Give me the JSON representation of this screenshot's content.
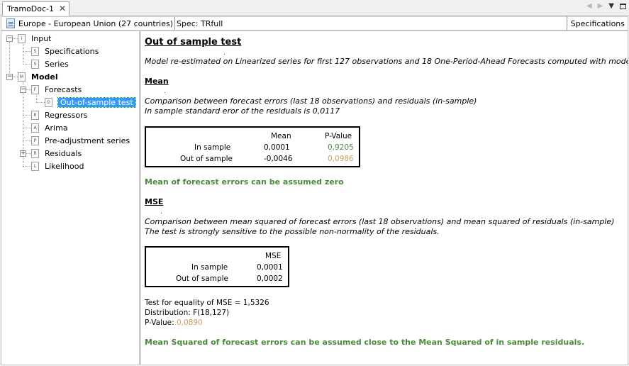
{
  "tab": {
    "title": "TramoDoc-1",
    "close": "✕"
  },
  "infobar": {
    "series_name": "Europe - European Union (27 countries)",
    "spec": "Spec: TRfull",
    "specifications_button": "Specifications"
  },
  "tree": {
    "input": "Input",
    "specifications": "Specifications",
    "series": "Series",
    "model": "Model",
    "forecasts": "Forecasts",
    "out_of_sample": "Out-of-sample test",
    "regressors": "Regressors",
    "arima": "Arima",
    "preadjustment": "Pre-adjustment series",
    "residuals": "Residuals",
    "likelihood": "Likelihood"
  },
  "report": {
    "title": "Out of sample test",
    "model_note": "Model re-estimated on Linearized series for first 127 observations and 18 One-Period-Ahead Forecasts computed with model fixed.",
    "mean": {
      "heading": "Mean",
      "desc1": "Comparison between forecast errors (last 18 observations) and residuals (in-sample)",
      "desc2": "In sample standard eror of the residuals is 0,0117",
      "table": {
        "col_mean": "Mean",
        "col_pvalue": "P-Value",
        "rows": [
          {
            "label": "In sample",
            "mean": "0,0001",
            "pvalue": "0,9205"
          },
          {
            "label": "Out of sample",
            "mean": "-0,0046",
            "pvalue": "0,0986"
          }
        ]
      },
      "conclusion": "Mean of forecast errors can be assumed zero"
    },
    "mse": {
      "heading": "MSE",
      "desc1": "Comparison between mean squared of forecast errors (last 18 observations) and mean squared of residuals (in-sample)",
      "desc2": "The test is strongly sensitive to the possible non-normality of the residuals.",
      "table": {
        "col_mse": "MSE",
        "rows": [
          {
            "label": "In sample",
            "mse": "0,0001"
          },
          {
            "label": "Out of sample",
            "mse": "0,0002"
          }
        ]
      },
      "test_line": "Test for equality of MSE = 1,5326",
      "distribution": "Distribution: F(18,127)",
      "pvalue_label": "P-Value: ",
      "pvalue": "0,0890",
      "conclusion": "Mean Squared of forecast errors can be assumed close to the Mean Squared of in sample residuals."
    }
  },
  "colors": {
    "accent_green": "#4a8a3c",
    "pvalue_tan": "#c8a060",
    "selection": "#3399ff"
  }
}
